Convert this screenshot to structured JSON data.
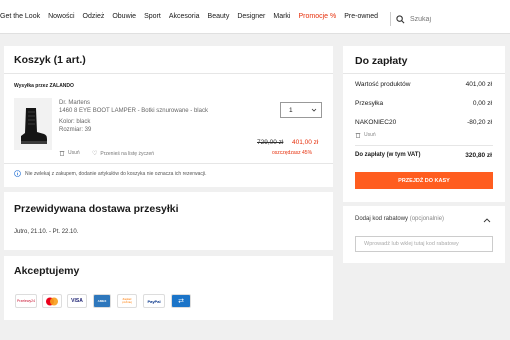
{
  "nav": {
    "items": [
      "Get the Look",
      "Nowości",
      "Odzież",
      "Obuwie",
      "Sport",
      "Akcesoria",
      "Beauty",
      "Designer",
      "Marki",
      "Promocje %",
      "Pre-owned"
    ],
    "search_placeholder": "Szukaj"
  },
  "cart": {
    "title": "Koszyk (1 art.)",
    "shipping_by": "Wysyłka przez ZALANDO",
    "item": {
      "brand": "Dr. Martens",
      "name": "1460 8 EYE BOOT LAMPER - Botki sznurowane - black",
      "color": "Kolor: black",
      "size": "Rozmiar: 39",
      "old_price": "729,00 zł",
      "price": "401,00 zł",
      "savings": "oszczędzasz 45%",
      "qty": "1",
      "remove": "Usuń",
      "wishlist": "Przenieś na listę życzeń"
    },
    "reserve_note": "Nie zwlekaj z zakupem, dodanie artykułów do koszyka nie oznacza ich rezerwacji."
  },
  "delivery": {
    "title": "Przewidywana dostawa przesyłki",
    "range": "Jutro, 21.10. - Pt. 22.10."
  },
  "payment": {
    "title": "Akceptujemy",
    "methods": [
      "Przelewy24",
      "Mastercard",
      "VISA",
      "AMEX",
      "Zapłać później",
      "PayPal",
      "Pobranie"
    ]
  },
  "summary": {
    "title": "Do zapłaty",
    "rows": [
      {
        "label": "Wartość produktów",
        "value": "401,00 zł"
      },
      {
        "label": "Przesyłka",
        "value": "0,00 zł"
      },
      {
        "label": "NAKONIEC20",
        "value": "-80,20 zł"
      }
    ],
    "remove_code": "Usuń",
    "total_label": "Do zapłaty (w tym VAT)",
    "total_value": "320,80 zł",
    "button": "PRZEJDŹ DO KASY"
  },
  "coupon": {
    "label": "Dodaj kod rabatowy",
    "optional": "(opcjonalnie)",
    "placeholder": "Wprowadź lub wklej tutaj kod rabatowy"
  },
  "colors": {
    "accent": "#ff5d1f",
    "sale": "#e6300c"
  }
}
